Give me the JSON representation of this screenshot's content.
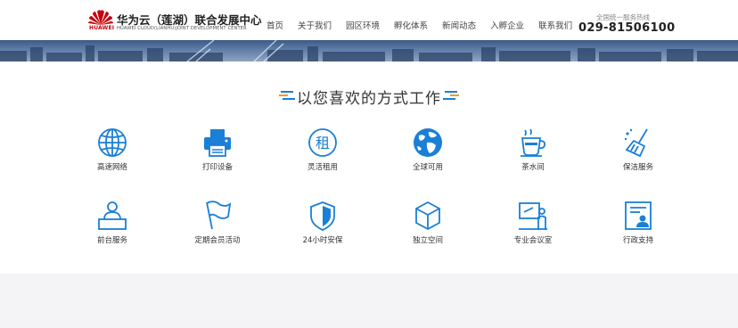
{
  "brand": {
    "logo_word": "HUAWEI",
    "title": "华为云（莲湖）联合发展中心",
    "subtitle": "HUAWEI CLOUD(LIANHU)JOINT DEVELOPMENT CENTER"
  },
  "nav": {
    "items": [
      {
        "label": "首页"
      },
      {
        "label": "关于我们"
      },
      {
        "label": "园区环境"
      },
      {
        "label": "孵化体系"
      },
      {
        "label": "新闻动态"
      },
      {
        "label": "入孵企业"
      },
      {
        "label": "联系我们"
      }
    ]
  },
  "hotline": {
    "label": "全国统一服务热线",
    "number": "029-81506100"
  },
  "section": {
    "title": "以您喜欢的方式工作"
  },
  "features": [
    {
      "label": "高速网络",
      "icon": "globe-icon"
    },
    {
      "label": "打印设备",
      "icon": "printer-icon"
    },
    {
      "label": "灵活租用",
      "icon": "rent-icon"
    },
    {
      "label": "全球可用",
      "icon": "earth-icon"
    },
    {
      "label": "茶水间",
      "icon": "tea-cup-icon"
    },
    {
      "label": "保洁服务",
      "icon": "broom-icon"
    },
    {
      "label": "前台服务",
      "icon": "reception-desk-icon"
    },
    {
      "label": "定期会员活动",
      "icon": "flag-icon"
    },
    {
      "label": "24小时安保",
      "icon": "shield-icon"
    },
    {
      "label": "独立空间",
      "icon": "cube-icon"
    },
    {
      "label": "专业会议室",
      "icon": "presentation-icon"
    },
    {
      "label": "行政支持",
      "icon": "admin-support-icon"
    }
  ],
  "colors": {
    "accent": "#1a7fd6",
    "brand_red": "#c7000b",
    "deco_orange": "#f39a1e"
  }
}
